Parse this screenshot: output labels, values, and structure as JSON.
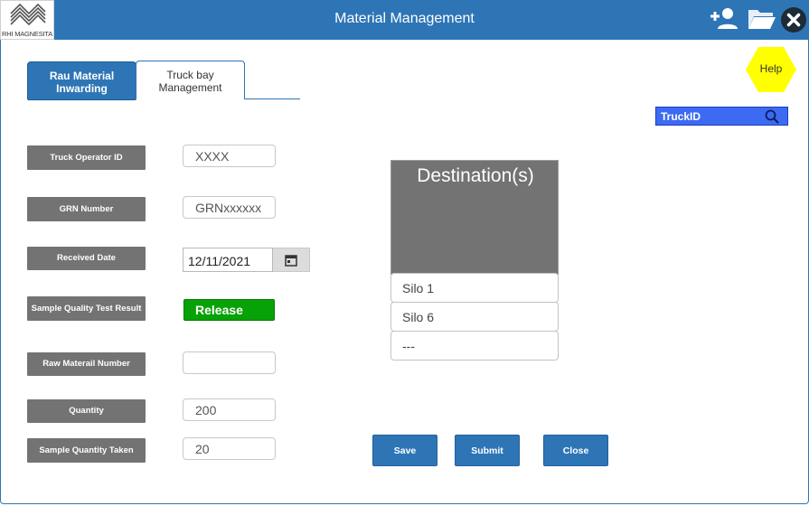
{
  "header": {
    "brand": "RHI MAGNESITA",
    "title": "Material Management",
    "icons": [
      "add-user-icon",
      "folder-icon",
      "close-icon"
    ]
  },
  "tabs": [
    {
      "label": "Rau Material Inwarding",
      "active": false
    },
    {
      "label": "Truck bay Management",
      "active": true
    }
  ],
  "help": {
    "label": "Help",
    "color": "#ffff00"
  },
  "search": {
    "placeholder": "TruckID",
    "icon": "search-icon"
  },
  "form": {
    "truck_operator": {
      "label": "Truck Operator ID",
      "value": "XXXX"
    },
    "grn": {
      "label": "GRN Number",
      "value": "GRNxxxxxx"
    },
    "received_date": {
      "label": "Received Date",
      "value": "12/11/2021",
      "icon": "calendar-icon"
    },
    "quality": {
      "label": "Sample Quality Test Result",
      "value": "Release",
      "color": "#07a207"
    },
    "raw_material": {
      "label": "Raw Materail Number",
      "value": ""
    },
    "quantity": {
      "label": "Quantity",
      "value": "200"
    },
    "sample_taken": {
      "label": "Sample Quantity Taken",
      "value": "20"
    }
  },
  "destinations": {
    "title": "Destination(s)",
    "items": [
      "Silo 1",
      "Silo 6",
      "---"
    ]
  },
  "actions": {
    "save": "Save",
    "submit": "Submit",
    "close": "Close"
  },
  "colors": {
    "primary": "#2e75b6",
    "label_bg": "#737373",
    "search_bg": "#3d6af2"
  }
}
